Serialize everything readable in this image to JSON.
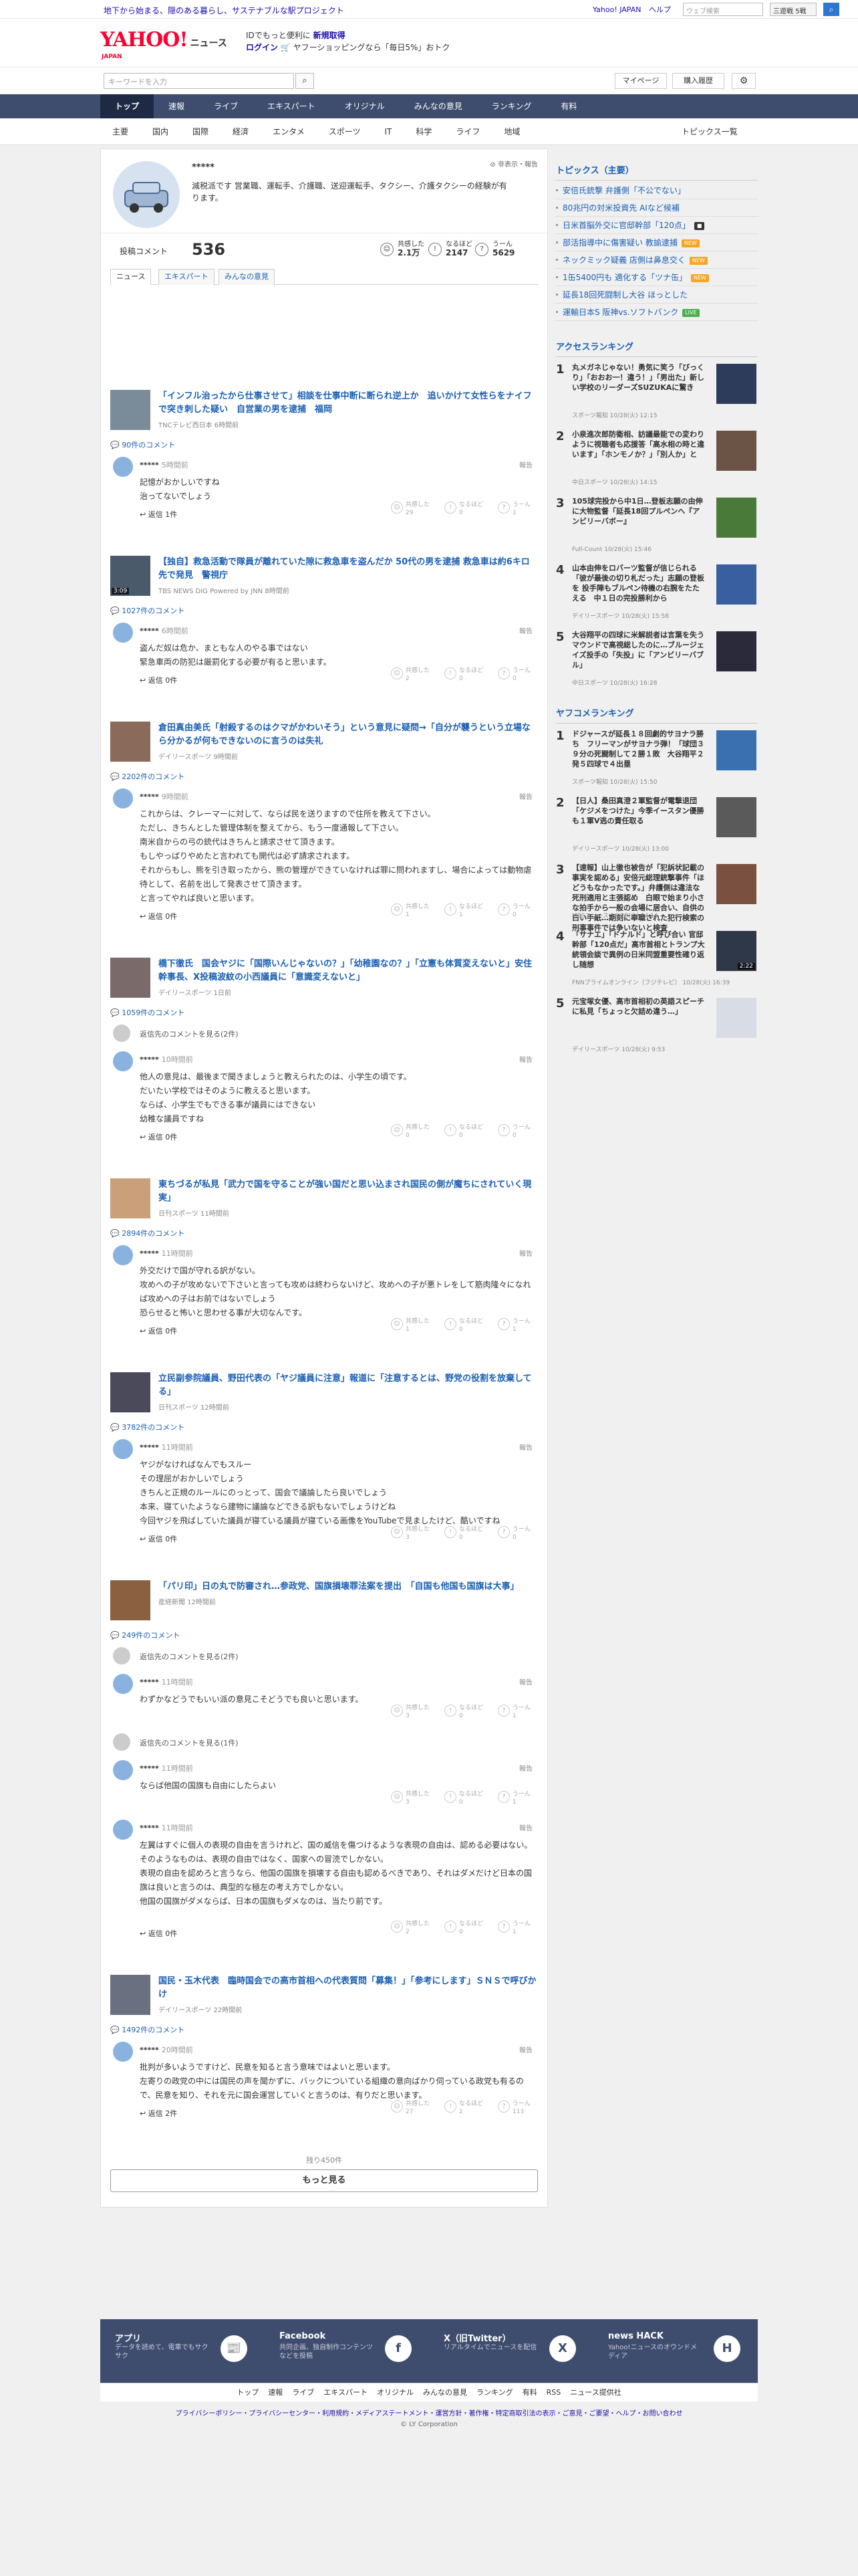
{
  "top": {
    "promo": "地下から始まる、隠のある暮らし、サステナブルな駅プロジェクト",
    "links": [
      "Yahoo! JAPAN",
      "ヘルプ"
    ],
    "web_search_placeholder": "ウェブ検索",
    "search_option": "三遊戦 5戦"
  },
  "header": {
    "logo": "YAHOO!",
    "logo_news": "ニュース",
    "logo_sub": "JAPAN",
    "promo_line1_prefix": "IDでもっと便利に",
    "promo_line1_link": "新規取得",
    "promo_line2_link1": "ログイン",
    "promo_line2_rest": "ヤフーショッピングなら「毎日5%」おトク"
  },
  "search": {
    "placeholder": "キーワードを入力",
    "mypage": "マイページ",
    "history": "購入履歴"
  },
  "nav": {
    "main": [
      "トップ",
      "速報",
      "ライブ",
      "エキスパート",
      "オリジナル",
      "みんなの意見",
      "ランキング",
      "有料"
    ],
    "sub": [
      "主要",
      "国内",
      "国際",
      "経済",
      "エンタメ",
      "スポーツ",
      "IT",
      "科学",
      "ライフ",
      "地域"
    ],
    "all_topics": "トピックス一覧"
  },
  "profile": {
    "name": "*****",
    "bio": "減税派です 営業職、運転手、介護職、送迎運転手、タクシー、介護タクシーの経験が有ります。",
    "flag": "非表示・報告",
    "comment_label": "投稿コメント",
    "comment_count": "536",
    "stats": [
      {
        "label": "共感した",
        "value": "2.1万"
      },
      {
        "label": "なるほど",
        "value": "2147"
      },
      {
        "label": "うーん",
        "value": "5629"
      }
    ]
  },
  "tabs": [
    "ニュース",
    "エキスパート",
    "みんなの意見"
  ],
  "articles": [
    {
      "title": "「インフル治ったから仕事させて」相談を仕事中断に断られ逆上か　追いかけて女性らをナイフで突き刺した疑い　自営業の男を逮捕　福岡",
      "source": "TNCテレビ西日本 6時間前",
      "count": "90件のコメント",
      "comments": [
        {
          "name": "*****",
          "time": "5時間前",
          "text": "記憶がおかしいですね\n治ってないでしょう",
          "reply": "返信 1件",
          "r": [
            "29",
            "0",
            "1"
          ]
        }
      ]
    },
    {
      "title": "【独自】救急活動で隊員が離れていた隙に救急車を盗んだか 50代の男を逮捕 救急車は約6キロ先で発見　警視庁",
      "source": "TBS NEWS DIG Powered by JNN 8時間前",
      "count": "1027件のコメント",
      "video": "3:09",
      "comments": [
        {
          "name": "*****",
          "time": "6時間前",
          "text": "盗んだ奴は危か、まともな人のやる事ではない\n緊急車両の防犯は厳罰化する必要が有ると思います。",
          "reply": "返信 0件",
          "r": [
            "2",
            "0",
            "0"
          ]
        }
      ]
    },
    {
      "title": "倉田真由美氏「射殺するのはクマがかわいそう」という意見に疑問→「自分が襲うという立場なら分かるが何もできないのに言うのは失礼",
      "source": "デイリースポーツ 9時間前",
      "count": "2202件のコメント",
      "comments": [
        {
          "name": "*****",
          "time": "9時間前",
          "text": "これからは、クレーマーに対して、ならば民を送りますので住所を教えて下さい。\nただし、きちんとした管理体制を整えてから、もう一度通報して下さい。\n南米自からの弓の銃代はきちんと請求させて頂きます。\nもしやっぱりやめたと言われても開代は必ず請求されます。\nそれからもし、熊を引き取ったから、熊の管理ができていなければ罪に問われますし、場合によっては動物虐待として、名前を出して発表させて頂きます。\nと言ってやれば良いと思います。",
          "reply": "返信 0件",
          "r": [
            "1",
            "1",
            "0"
          ]
        }
      ]
    },
    {
      "title": "橋下徹氏　国会ヤジに「国際いんじゃないの？」「幼稚園なの？」「立憲も体質変えないと」安住幹事長、X投稿波紋の小西議員に「意識変えないと」",
      "source": "デイリースポーツ 1日前",
      "count": "1059件のコメント",
      "gray": "返信先のコメントを見る(2件)",
      "comments": [
        {
          "name": "*****",
          "time": "10時間前",
          "text": "他人の意見は、最後まで聞きましょうと教えられたのは、小学生の頃です。\nだいたい学校ではそのように教えると思います。\nならば、小学生でもできる事が議員にはできない\n幼稚な議員ですね",
          "reply": "返信 0件",
          "r": [
            "0",
            "0",
            "0"
          ]
        }
      ]
    },
    {
      "title": "東ちづるが私見「武力で国を守ることが強い国だと思い込まされ国民の側が魔ちにされていく現実」",
      "source": "日刊スポーツ 11時間前",
      "count": "2894件のコメント",
      "comments": [
        {
          "name": "*****",
          "time": "11時間前",
          "text": "外交だけで国が守れる訳がない。\n攻めへの子が攻めないで下さいと言っても攻めは終わらないけど、攻めへの子が悪トレをして筋肉隆々になれば攻めへの子はお前ではないでしょう\n恐らせると怖いと思わせる事が大切なんです。",
          "reply": "返信 0件",
          "r": [
            "1",
            "0",
            "1"
          ]
        }
      ]
    },
    {
      "title": "立民副参院議員、野田代表の「ヤジ議員に注意」報道に「注意するとは、野党の役割を放棄してる」",
      "source": "日刊スポーツ 12時間前",
      "count": "3782件のコメント",
      "comments": [
        {
          "name": "*****",
          "time": "11時間前",
          "text": "ヤジがなければなんでもスルー\nその理屈がおかしいでしょう\nきちんと正規のルールにのっとって、国会で議論したら良いでしょう\n本来、寝ていたようなら建物に議論などできる訳もないでしょうけどね\n今回ヤジを飛ばしていた議員が寝ている議員が寝ている画像をYouTubeで見ましたけど、酷いですね",
          "reply": "返信 0件",
          "r": [
            "3",
            "0",
            "0"
          ]
        }
      ]
    },
    {
      "title": "「パリ印」日の丸で防審され…参政党、国旗損壊罪法案を提出　「自国も他国も国旗は大事」",
      "source": "産経新聞 12時間前",
      "count": "249件のコメント",
      "gray": "返信先のコメントを見る(2件)",
      "comments": [
        {
          "name": "*****",
          "time": "11時間前",
          "text": "わずかなどうでもいい派の意見こそどうでも良いと思います。",
          "reply": "",
          "r": [
            "3",
            "0",
            "1"
          ]
        }
      ],
      "gray2": "返信先のコメントを見る(1件)",
      "comments2": [
        {
          "name": "*****",
          "time": "11時間前",
          "text": "ならば他国の国旗も自由にしたらよい",
          "reply": "",
          "r": [
            "3",
            "0",
            "1"
          ]
        },
        {
          "name": "*****",
          "time": "11時間前",
          "text": "左翼はすぐに個人の表現の自由を言うけれど、国の威信を傷つけるような表現の自由は、認める必要はない。\nそのようなものは、表現の自由ではなく、国家への冒涜でしかない。\n表現の自由を認めろと言うなら、他国の国旗を損壊する自由も認めるべきであり、それはダメだけど日本の国旗は良いと言うのは、典型的な極左の考え方でしかない。\n他国の国旗がダメならば、日本の国旗もダメなのは、当たり前です。",
          "reply": "返信 0件",
          "r": [
            "2",
            "0",
            "1"
          ]
        }
      ]
    },
    {
      "title": "国民・玉木代表　臨時国会での高市首相への代表質問「募集！」「参考にします」ＳＮＳで呼びかけ",
      "source": "デイリースポーツ 22時間前",
      "count": "1492件のコメント",
      "comments": [
        {
          "name": "*****",
          "time": "20時間前",
          "text": "批判が多いようですけど、民意を知ると言う意味ではよいと思います。\n左寄りの政党の中には国民の声を聞かずに、バックについている組織の意向ばかり伺っている政党も有るので、民意を知り、それを元に国会運営していくと言うのは、有りだと思います。",
          "reply": "返信 2件",
          "r": [
            "27",
            "2",
            "113"
          ]
        }
      ]
    }
  ],
  "remaining": "残り450件",
  "more": "もっと見る",
  "reactions_labels": [
    "共感した",
    "なるほど",
    "うーん"
  ],
  "report_label": "報告",
  "sidebar": {
    "topics_title": "トピックス（主要）",
    "topics": [
      {
        "t": "安倍氏銃撃 弁護側「不公でない」"
      },
      {
        "t": "80兆円の対米投資先 AIなど候補"
      },
      {
        "t": "日米首脳外交に官邸幹部「120点」",
        "b": "■",
        "bc": "#333"
      },
      {
        "t": "部活指導中に傷害疑い 教諭逮捕",
        "b": "NEW",
        "bc": "#f5a623"
      },
      {
        "t": "ネックミック疑義 店側は鼻息交く",
        "b": "NEW",
        "bc": "#f5a623"
      },
      {
        "t": "1缶5400円も 適化する「ツナ缶」",
        "b": "NEW",
        "bc": "#f5a623"
      },
      {
        "t": "延長18回死闘制し大谷 ほっとした"
      },
      {
        "t": "運輸日本S 阪神vs.ソフトバンク",
        "b": "LIVE",
        "bc": "#4caf50"
      }
    ],
    "access_title": "アクセスランキング",
    "access": [
      {
        "n": "1",
        "t": "丸メガネじゃない！勇気に笑う「びっくり」「おおお一！違う！」「男出た」新しい学校のリーダーズSUZUKAに驚き",
        "s": "スポーツ報知 10/28(火) 12:15"
      },
      {
        "n": "2",
        "t": "小泉進次郎防衛相、訪議最能での変わりように視聴者も応援答「高水相の時と違います」「ホンモノか？」「別人か」と",
        "s": "中日スポーツ 10/28(火) 14:15"
      },
      {
        "n": "3",
        "t": "105球完投から中1日…登板志願の由伸に大物監督「延長18回プルペンへ『アンビリーバボー』",
        "s": "Full-Count 10/28(火) 15:46"
      },
      {
        "n": "4",
        "t": "山本由伸をロバーツ監督が信じられる「彼が最後の切り札だった」志願の登板を 投手陣もブルペン待機の右腕をたたえる　中１日の完投勝利から",
        "s": "デイリースポーツ 10/28(火) 15:58"
      },
      {
        "n": "5",
        "t": "大谷翔平の四球に米解説者は言葉を失う マウンドで高視総したのに…ブルージェイズ投手の「失投」に「アンビリーバブル」",
        "s": "中日スポーツ 10/28(火) 16:28"
      }
    ],
    "yahoo_title": "ヤフコメランキング",
    "yahoo": [
      {
        "n": "1",
        "t": "ドジャースが延長１８回劇的サヨナラ勝ち　フリーマンがサヨナラ弾！「球団３９分の死闘制して２勝１敗　大谷翔平２発５四球で４出塁",
        "s": "スポーツ報知 10/28(火) 15:50"
      },
      {
        "n": "2",
        "t": "【日人】桑田真澄２軍監督が電撃退団「ケジメをつけた」今季イースタン優勝も１軍V逃の責任取る",
        "s": "デイリースポーツ 10/28(火) 13:00"
      },
      {
        "n": "3",
        "t": "【速報】山上徹也被告が「犯訴状記載の事実を認める」安倍元総理銃撃事件「ほどうもなかったです。」弁護側は違法な死刑適用と主張認め　白眼で始まり小さな拍手から一般の会場に居合い、自供の白い手紙…期刻に奉職された犯行検索の刑事事件では争いないと検査",
        "s": "MBSニュース 10/28(火) 14:14"
      },
      {
        "n": "4",
        "t": "「サナエ」「ドナルド」と呼び合い 官邸幹部「120点だ」高市首相とトランプ大統領会談で異例の日米同盟重要性確り返し随想",
        "s": "FNNプライムオンライン（フジテレビ） 10/28(火) 16:39",
        "video": "2:22"
      },
      {
        "n": "5",
        "t": "元宝塚女優、高市首相初の英語スピーチに私見「ちょっと欠詰め違う…」",
        "s": "デイリースポーツ 10/28(火) 9:53"
      }
    ]
  },
  "footer": {
    "blocks": [
      {
        "t": "アプリ",
        "d": "データを読めて、電車でもサクサク",
        "i": "📰"
      },
      {
        "t": "Facebook",
        "d": "共同企画、独自制作コンテンツなどを投稿",
        "i": "f"
      },
      {
        "t": "X（旧Twitter）",
        "d": "リアルタイムでニュースを配信",
        "i": "X"
      },
      {
        "t": "news HACK",
        "d": "Yahoo!ニュースのオウンドメディア",
        "i": "H"
      }
    ],
    "nav": [
      "トップ",
      "速報",
      "ライブ",
      "エキスパート",
      "オリジナル",
      "みんなの意見",
      "ランキング",
      "有料",
      "RSS",
      "ニュース提供社"
    ],
    "links": "プライバシーポリシー・プライバシーセンター・利用規約・メディアステートメント・運営方針・著作権・特定商取引法の表示・ご意見・ご要望・ヘルプ・お問い合わせ",
    "copyright": "© LY Corporation"
  }
}
